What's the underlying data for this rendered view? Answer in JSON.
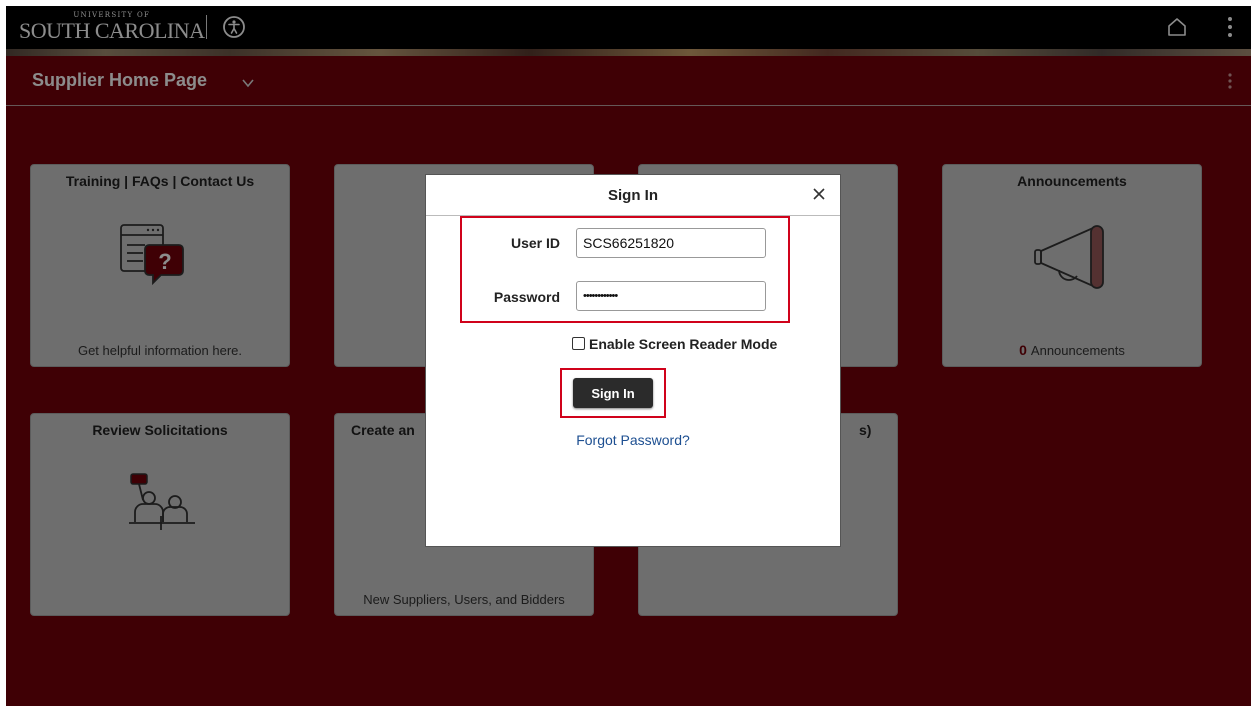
{
  "header": {
    "logo_top": "UNIVERSITY OF",
    "logo_main": "SOUTH CAROLINA",
    "icons": [
      "accessibility-icon",
      "home-icon",
      "more-options-icon"
    ]
  },
  "page": {
    "title": "Supplier Home Page"
  },
  "tiles": [
    {
      "title": "Training | FAQs | Contact Us",
      "footer": "Get helpful information here.",
      "icon": "help-document-icon"
    },
    {
      "title": "",
      "footer": "",
      "icon": ""
    },
    {
      "title": "",
      "footer": "",
      "icon": ""
    },
    {
      "title": "Announcements",
      "footer_count": "0",
      "footer": "Announcements",
      "icon": "megaphone-icon"
    },
    {
      "title": "Review Solicitations",
      "footer": "",
      "icon": "bidding-icon"
    },
    {
      "title": "Create an",
      "footer": "New Suppliers, Users, and Bidders",
      "icon": ""
    },
    {
      "title": "s)",
      "footer": "",
      "icon": ""
    }
  ],
  "modal": {
    "title": "Sign In",
    "user_id_label": "User ID",
    "user_id_value": "SCS66251820",
    "password_label": "Password",
    "password_value": "••••••••••••",
    "screen_reader_label": "Enable Screen Reader Mode",
    "sign_in_button": "Sign In",
    "forgot_link": "Forgot Password?"
  },
  "colors": {
    "brand_garnet": "#73000a",
    "highlight_red": "#d0021b",
    "link_blue": "#1d4f91"
  }
}
